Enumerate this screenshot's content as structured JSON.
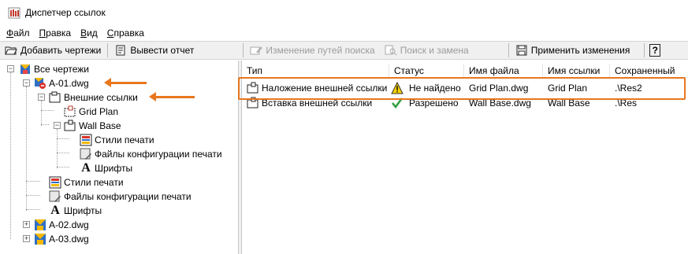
{
  "window": {
    "title": "Диспетчер ссылок"
  },
  "menu": [
    {
      "label": "Файл",
      "key": "Ф",
      "rest": "айл"
    },
    {
      "label": "Правка",
      "key": "П",
      "rest": "равка"
    },
    {
      "label": "Вид",
      "key": "В",
      "rest": "ид"
    },
    {
      "label": "Справка",
      "key": "С",
      "rest": "правка"
    }
  ],
  "toolbar": {
    "add_drawings": "Добавить чертежи",
    "report": "Вывести отчет",
    "change_paths": "Изменение путей поиска",
    "find_replace": "Поиск и замена",
    "apply_changes": "Применить изменения",
    "help_glyph": "?"
  },
  "tree": {
    "root": "Все чертежи",
    "drawing1": "A-01.dwg",
    "xrefs": "Внешние ссылки",
    "xref1": "Grid Plan",
    "xref2": "Wall Base",
    "xref2_styles": "Стили печати",
    "xref2_configs": "Файлы конфигурации печати",
    "xref2_fonts": "Шрифты",
    "d1_styles": "Стили печати",
    "d1_configs": "Файлы конфигурации печати",
    "d1_fonts": "Шрифты",
    "drawing2": "A-02.dwg",
    "drawing3": "A-03.dwg"
  },
  "grid": {
    "columns": [
      "Тип",
      "Статус",
      "Имя файла",
      "Имя ссылки",
      "Сохраненный"
    ],
    "rows": [
      {
        "type": "Наложение внешней ссылки",
        "status": "Не найдено",
        "status_icon": "warning-icon",
        "file": "Grid Plan.dwg",
        "ref": "Grid Plan",
        "saved": ".\\Res2"
      },
      {
        "type": "Вставка внешней ссылки",
        "status": "Разрешено",
        "status_icon": "checkmark-icon",
        "file": "Wall Base.dwg",
        "ref": "Wall Base",
        "saved": ".\\Res"
      }
    ]
  },
  "colors": {
    "accent_orange": "#e8771e",
    "warning_yellow": "#f5d000",
    "check_green": "#2e9e3c"
  }
}
